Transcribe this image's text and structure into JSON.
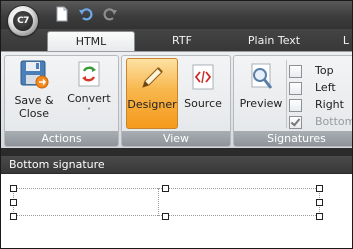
{
  "app": {
    "logo_text": "C7"
  },
  "quick_access": {
    "icons": [
      "new-document-icon",
      "undo-icon",
      "redo-icon"
    ]
  },
  "tabs": [
    {
      "label": "HTML",
      "active": true
    },
    {
      "label": "RTF",
      "active": false
    },
    {
      "label": "Plain Text",
      "active": false
    },
    {
      "label": "L",
      "active": false
    }
  ],
  "ribbon": {
    "actions": {
      "label": "Actions",
      "save_close": {
        "line1": "Save &",
        "line2": "Close",
        "icon": "floppy-disk-icon"
      },
      "convert": {
        "label": "Convert",
        "icon": "convert-arrows-icon",
        "dropdown": "˅"
      }
    },
    "view": {
      "label": "View",
      "designer": {
        "label": "Designer",
        "icon": "pencil-icon",
        "pressed": true
      },
      "source": {
        "label": "Source",
        "icon": "source-code-icon",
        "pressed": false
      }
    },
    "signatures": {
      "label": "Signatures",
      "preview": {
        "label": "Preview",
        "icon": "magnifier-icon"
      },
      "options": [
        {
          "label": "Top",
          "checked": false,
          "enabled": true
        },
        {
          "label": "Left",
          "checked": false,
          "enabled": true
        },
        {
          "label": "Right",
          "checked": false,
          "enabled": true
        },
        {
          "label": "Bottom",
          "checked": true,
          "enabled": false
        }
      ]
    }
  },
  "section": {
    "title": "Bottom signature"
  },
  "colors": {
    "accent": "#f6a631",
    "header_bg": "#3c3c3c",
    "ribbon_bg": "#e3e6e9"
  }
}
